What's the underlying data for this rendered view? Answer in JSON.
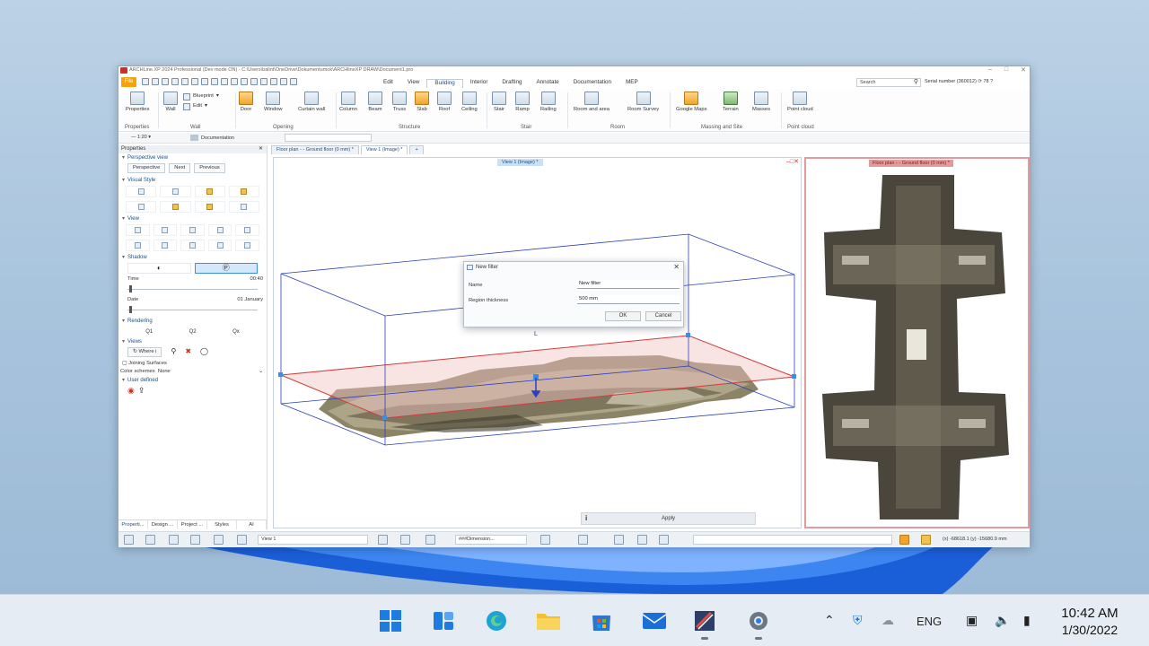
{
  "app": {
    "title": "ARCHLine.XP 2024 Professional (Dev mode ON) - C:\\Users\\balint\\OneDrive\\Dokumentumok\\ARCHlineXP DRAW\\Document1.pro",
    "file_tab": "File",
    "menu_tabs": [
      "Edit",
      "View",
      "Building",
      "Interior",
      "Drafting",
      "Annotate",
      "Documentation",
      "MEP"
    ],
    "active_tab": "Building",
    "search_placeholder": "Search",
    "serial": "Serial number (360012)",
    "serial_count": "78"
  },
  "ribbon": {
    "buttons": {
      "properties": "Properties",
      "wall": "Wall",
      "blueprint": "Blueprint",
      "edit": "Edit",
      "door": "Door",
      "window": "Window",
      "curtain_wall": "Curtain wall",
      "column": "Column",
      "beam": "Beam",
      "truss": "Truss",
      "slab": "Slab",
      "roof": "Roof",
      "ceiling": "Ceiling",
      "stair": "Stair",
      "ramp": "Ramp",
      "railing": "Railing",
      "room_and_area": "Room and area",
      "room_survey": "Room Survey",
      "google_maps": "Google Maps",
      "terrain": "Terrain",
      "masses": "Masses",
      "point_cloud": "Point cloud"
    },
    "groups": {
      "properties": "Properties",
      "wall": "Wall",
      "opening": "Opening",
      "structure": "Structure",
      "stair": "Stair",
      "room": "Room",
      "massing": "Massing and Site",
      "point_cloud": "Point cloud"
    }
  },
  "toolrow": {
    "scale": "1:20",
    "layer": "Documentation"
  },
  "properties_panel": {
    "header": "Properties",
    "perspective_view": "Perspective view",
    "perspective": "Perspective",
    "next": "Next",
    "previous": "Previous",
    "visual_style": "Visual Style",
    "view": "View",
    "shadow": "Shadow",
    "time_label": "Time",
    "time_value": "00:40",
    "date_label": "Date",
    "date_value": "01 January",
    "rendering": "Rendering",
    "q1": "Q1",
    "q2": "Q2",
    "qx": "Qx",
    "views": "Views",
    "where": "Where i",
    "joining_surfaces": "Joining Surfaces",
    "color_schemes_label": "Color schemes",
    "color_schemes_value": "None",
    "user_defined": "User defined",
    "bottom_tabs": [
      "Properti...",
      "Design ...",
      "Project ...",
      "Styles",
      "AI"
    ]
  },
  "doc_tabs": [
    "Floor plan - - Ground floor (0 mm) *",
    "View 1 (Image) *",
    "+"
  ],
  "viewport": {
    "label": "View 1 (Image) *"
  },
  "dialog": {
    "title": "New filter",
    "name_label": "Name",
    "name_value": "New filter",
    "region_label": "Region thickness",
    "region_value": "500 mm",
    "ok": "OK",
    "cancel": "Cancel"
  },
  "apply_bar": {
    "label": "Apply"
  },
  "floorplan": {
    "label": "Floor plan - - Ground floor (0 mm) *"
  },
  "statusbar": {
    "view_select": "View 1",
    "dimension": "###Dimension...",
    "coords": "(x) -68618.1 (y) -15680.9 mm"
  },
  "taskbar": {
    "language": "ENG",
    "time": "10:42 AM",
    "date": "1/30/2022"
  },
  "colors": {
    "accent": "#1a4f8a",
    "file_tab": "#f2a30f",
    "floor_border": "#e29a9a",
    "box_lines": "#2b3fbf",
    "section_plane": "#d23c3c"
  }
}
